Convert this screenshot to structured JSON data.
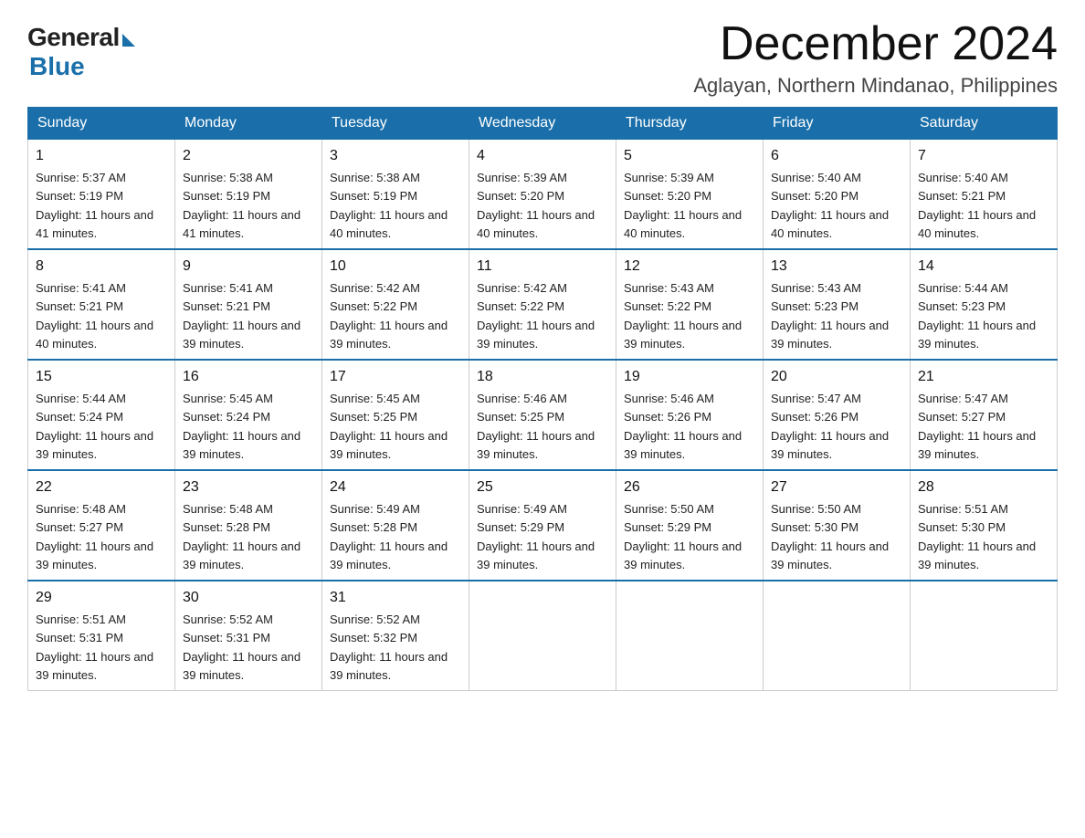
{
  "logo": {
    "general": "General",
    "blue": "Blue"
  },
  "header": {
    "month": "December 2024",
    "location": "Aglayan, Northern Mindanao, Philippines"
  },
  "days_of_week": [
    "Sunday",
    "Monday",
    "Tuesday",
    "Wednesday",
    "Thursday",
    "Friday",
    "Saturday"
  ],
  "weeks": [
    [
      {
        "day": "1",
        "sunrise": "5:37 AM",
        "sunset": "5:19 PM",
        "daylight": "11 hours and 41 minutes."
      },
      {
        "day": "2",
        "sunrise": "5:38 AM",
        "sunset": "5:19 PM",
        "daylight": "11 hours and 41 minutes."
      },
      {
        "day": "3",
        "sunrise": "5:38 AM",
        "sunset": "5:19 PM",
        "daylight": "11 hours and 40 minutes."
      },
      {
        "day": "4",
        "sunrise": "5:39 AM",
        "sunset": "5:20 PM",
        "daylight": "11 hours and 40 minutes."
      },
      {
        "day": "5",
        "sunrise": "5:39 AM",
        "sunset": "5:20 PM",
        "daylight": "11 hours and 40 minutes."
      },
      {
        "day": "6",
        "sunrise": "5:40 AM",
        "sunset": "5:20 PM",
        "daylight": "11 hours and 40 minutes."
      },
      {
        "day": "7",
        "sunrise": "5:40 AM",
        "sunset": "5:21 PM",
        "daylight": "11 hours and 40 minutes."
      }
    ],
    [
      {
        "day": "8",
        "sunrise": "5:41 AM",
        "sunset": "5:21 PM",
        "daylight": "11 hours and 40 minutes."
      },
      {
        "day": "9",
        "sunrise": "5:41 AM",
        "sunset": "5:21 PM",
        "daylight": "11 hours and 39 minutes."
      },
      {
        "day": "10",
        "sunrise": "5:42 AM",
        "sunset": "5:22 PM",
        "daylight": "11 hours and 39 minutes."
      },
      {
        "day": "11",
        "sunrise": "5:42 AM",
        "sunset": "5:22 PM",
        "daylight": "11 hours and 39 minutes."
      },
      {
        "day": "12",
        "sunrise": "5:43 AM",
        "sunset": "5:22 PM",
        "daylight": "11 hours and 39 minutes."
      },
      {
        "day": "13",
        "sunrise": "5:43 AM",
        "sunset": "5:23 PM",
        "daylight": "11 hours and 39 minutes."
      },
      {
        "day": "14",
        "sunrise": "5:44 AM",
        "sunset": "5:23 PM",
        "daylight": "11 hours and 39 minutes."
      }
    ],
    [
      {
        "day": "15",
        "sunrise": "5:44 AM",
        "sunset": "5:24 PM",
        "daylight": "11 hours and 39 minutes."
      },
      {
        "day": "16",
        "sunrise": "5:45 AM",
        "sunset": "5:24 PM",
        "daylight": "11 hours and 39 minutes."
      },
      {
        "day": "17",
        "sunrise": "5:45 AM",
        "sunset": "5:25 PM",
        "daylight": "11 hours and 39 minutes."
      },
      {
        "day": "18",
        "sunrise": "5:46 AM",
        "sunset": "5:25 PM",
        "daylight": "11 hours and 39 minutes."
      },
      {
        "day": "19",
        "sunrise": "5:46 AM",
        "sunset": "5:26 PM",
        "daylight": "11 hours and 39 minutes."
      },
      {
        "day": "20",
        "sunrise": "5:47 AM",
        "sunset": "5:26 PM",
        "daylight": "11 hours and 39 minutes."
      },
      {
        "day": "21",
        "sunrise": "5:47 AM",
        "sunset": "5:27 PM",
        "daylight": "11 hours and 39 minutes."
      }
    ],
    [
      {
        "day": "22",
        "sunrise": "5:48 AM",
        "sunset": "5:27 PM",
        "daylight": "11 hours and 39 minutes."
      },
      {
        "day": "23",
        "sunrise": "5:48 AM",
        "sunset": "5:28 PM",
        "daylight": "11 hours and 39 minutes."
      },
      {
        "day": "24",
        "sunrise": "5:49 AM",
        "sunset": "5:28 PM",
        "daylight": "11 hours and 39 minutes."
      },
      {
        "day": "25",
        "sunrise": "5:49 AM",
        "sunset": "5:29 PM",
        "daylight": "11 hours and 39 minutes."
      },
      {
        "day": "26",
        "sunrise": "5:50 AM",
        "sunset": "5:29 PM",
        "daylight": "11 hours and 39 minutes."
      },
      {
        "day": "27",
        "sunrise": "5:50 AM",
        "sunset": "5:30 PM",
        "daylight": "11 hours and 39 minutes."
      },
      {
        "day": "28",
        "sunrise": "5:51 AM",
        "sunset": "5:30 PM",
        "daylight": "11 hours and 39 minutes."
      }
    ],
    [
      {
        "day": "29",
        "sunrise": "5:51 AM",
        "sunset": "5:31 PM",
        "daylight": "11 hours and 39 minutes."
      },
      {
        "day": "30",
        "sunrise": "5:52 AM",
        "sunset": "5:31 PM",
        "daylight": "11 hours and 39 minutes."
      },
      {
        "day": "31",
        "sunrise": "5:52 AM",
        "sunset": "5:32 PM",
        "daylight": "11 hours and 39 minutes."
      },
      null,
      null,
      null,
      null
    ]
  ]
}
